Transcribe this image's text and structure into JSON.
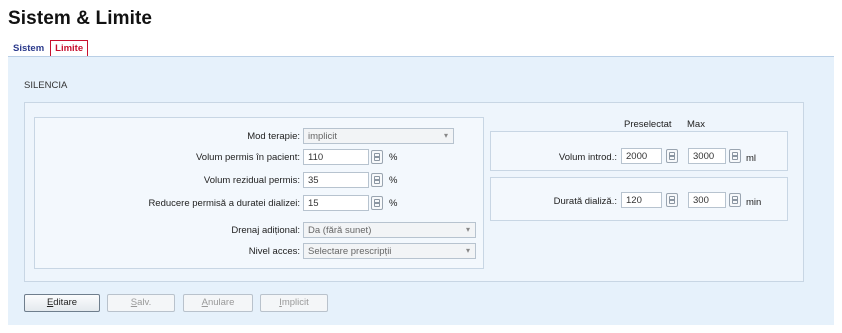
{
  "page": {
    "title": "Sistem & Limite"
  },
  "tabs": [
    {
      "label": "Sistem",
      "active": false
    },
    {
      "label": "Limite",
      "active": true
    }
  ],
  "section_label": "SILENCIA",
  "therapy": {
    "mode": {
      "label": "Mod terapie:",
      "value": "implicit"
    },
    "allowed_volume": {
      "label": "Volum permis în pacient:",
      "value": "110",
      "unit": "%"
    },
    "residual_volume": {
      "label": "Volum rezidual permis:",
      "value": "35",
      "unit": "%"
    },
    "dialysis_reduction": {
      "label": "Reducere permisă a duratei dializei:",
      "value": "15",
      "unit": "%"
    },
    "extra_drain": {
      "label": "Drenaj adițional:",
      "value": "Da (fără sunet)"
    },
    "access_level": {
      "label": "Nivel acces:",
      "value": "Selectare prescripții"
    }
  },
  "limits": {
    "col_preselected": "Preselectat",
    "col_max": "Max",
    "fill_volume": {
      "label": "Volum introd.:",
      "preselected": "2000",
      "max": "3000",
      "unit": "ml"
    },
    "dialysis_duration": {
      "label": "Durată dializă.:",
      "preselected": "120",
      "max": "300",
      "unit": "min"
    }
  },
  "buttons": {
    "edit": {
      "first": "E",
      "rest": "ditare"
    },
    "save": {
      "first": "S",
      "rest": "alv."
    },
    "cancel": {
      "first": "A",
      "rest": "nulare"
    },
    "default": {
      "first": "I",
      "rest": "mplicit"
    }
  }
}
